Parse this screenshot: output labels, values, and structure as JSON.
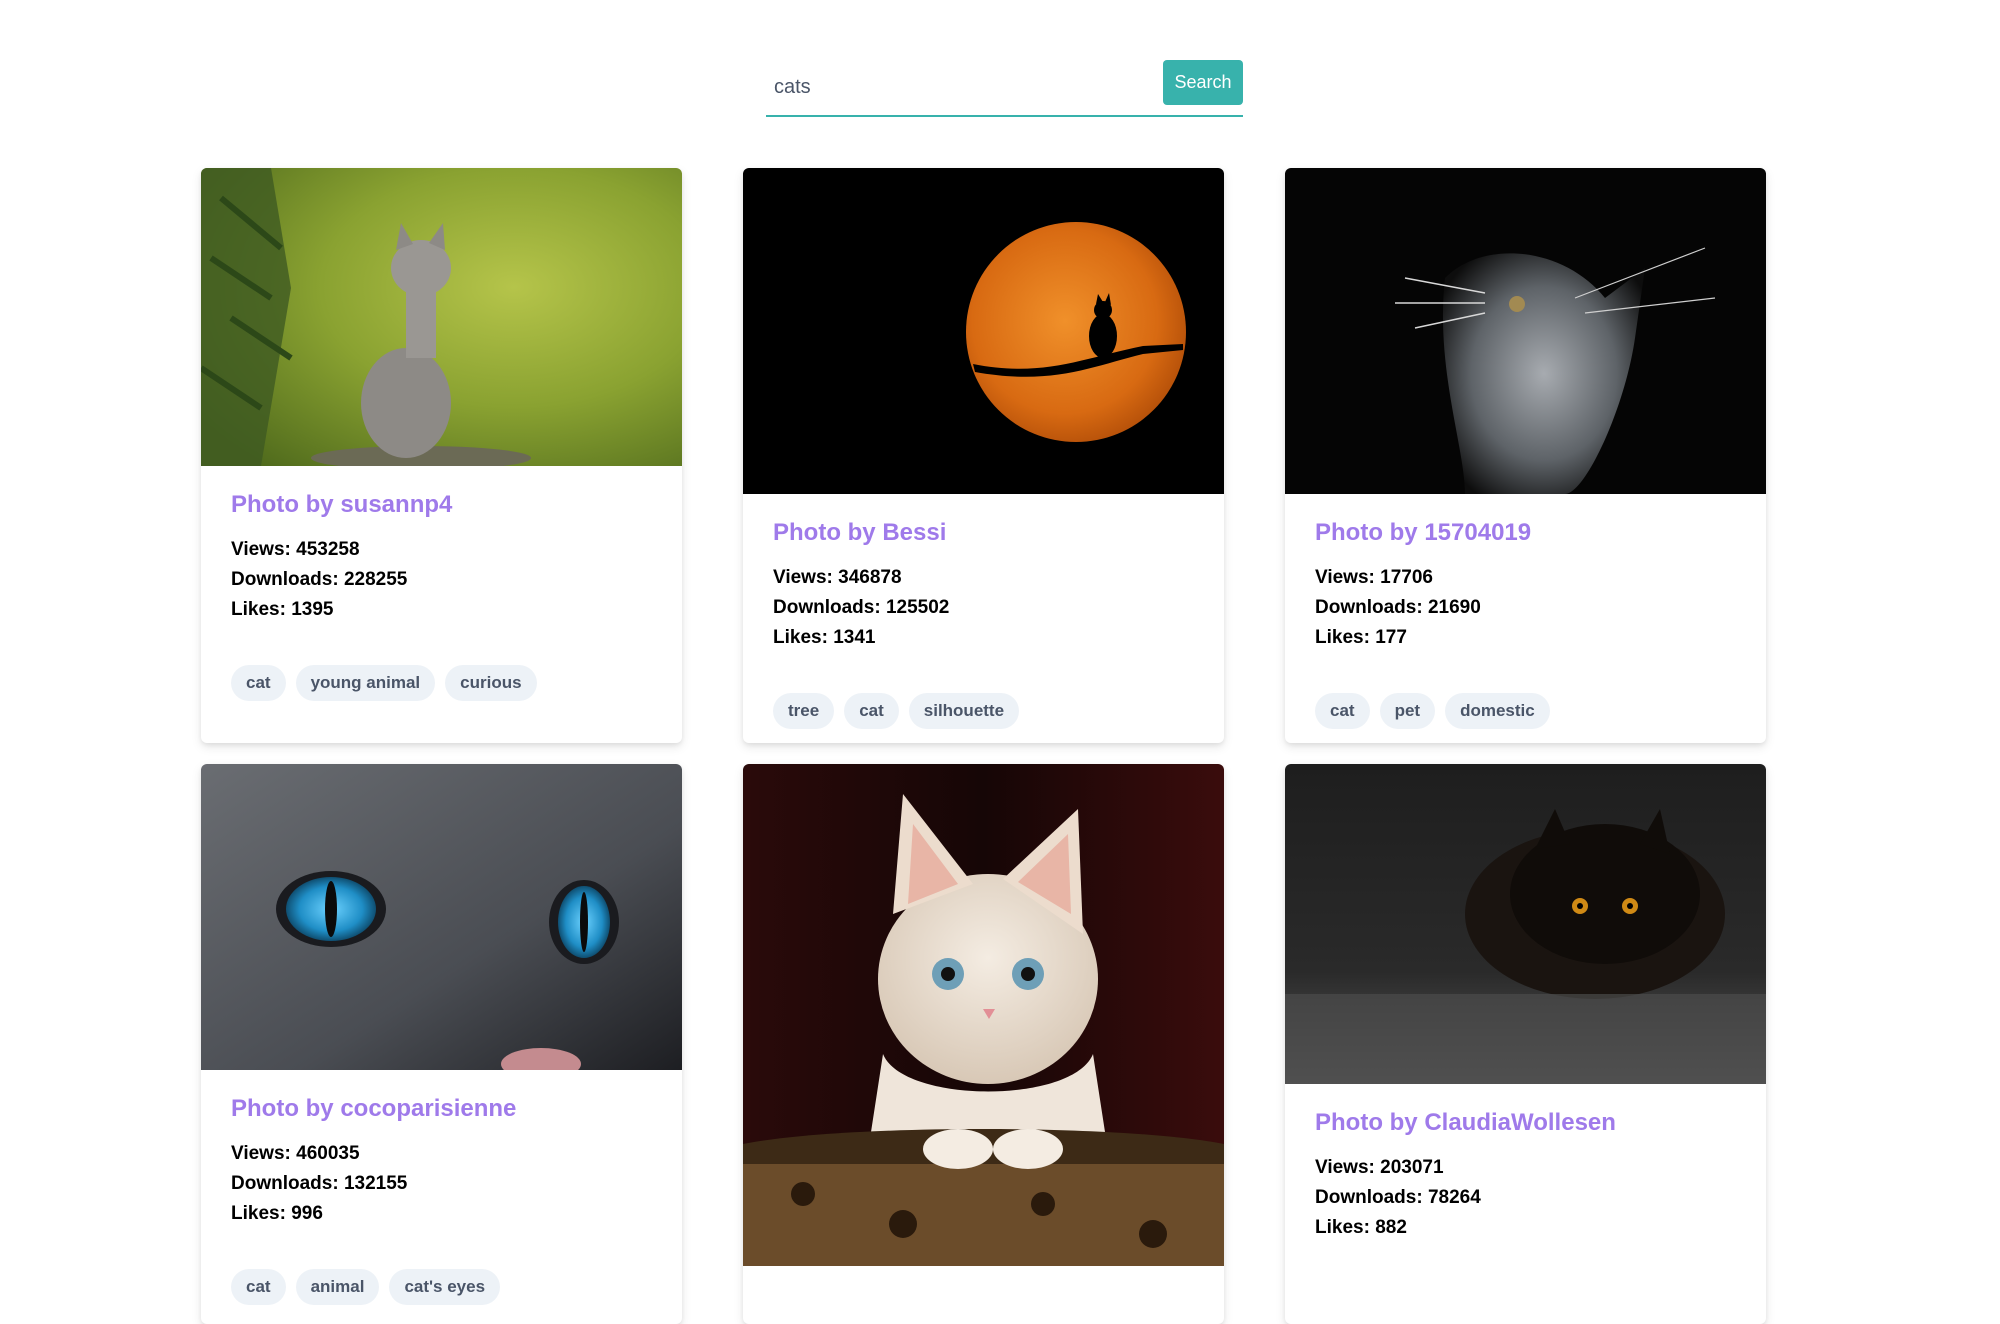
{
  "search": {
    "query": "cats",
    "button_label": "Search"
  },
  "cards": [
    {
      "title": "Photo by susannp4",
      "views": "Views: 453258",
      "downloads": "Downloads: 228255",
      "likes": "Likes: 1395",
      "tags": [
        "cat",
        "young animal",
        "curious"
      ],
      "image_icon": "kitten-on-branch-image"
    },
    {
      "title": "Photo by Bessi",
      "views": "Views: 346878",
      "downloads": "Downloads: 125502",
      "likes": "Likes: 1341",
      "tags": [
        "tree",
        "cat",
        "silhouette"
      ],
      "image_icon": "cat-moon-silhouette-image"
    },
    {
      "title": "Photo by 15704019",
      "views": "Views: 17706",
      "downloads": "Downloads: 21690",
      "likes": "Likes: 177",
      "tags": [
        "cat",
        "pet",
        "domestic"
      ],
      "image_icon": "gray-cat-profile-image"
    },
    {
      "title": "Photo by cocoparisienne",
      "views": "Views: 460035",
      "downloads": "Downloads: 132155",
      "likes": "Likes: 996",
      "tags": [
        "cat",
        "animal",
        "cat's eyes"
      ],
      "image_icon": "cat-blue-eyes-image"
    },
    {
      "title": "",
      "views": "",
      "downloads": "",
      "likes": "",
      "tags": [],
      "image_icon": "white-kitten-image"
    },
    {
      "title": "Photo by ClaudiaWollesen",
      "views": "Views: 203071",
      "downloads": "Downloads: 78264",
      "likes": "Likes: 882",
      "tags": [],
      "image_icon": "black-cat-image"
    }
  ],
  "colors": {
    "accent": "#38b2ac",
    "title": "#9f7aea",
    "tag_bg": "#edf2f7",
    "tag_text": "#4a5568"
  }
}
